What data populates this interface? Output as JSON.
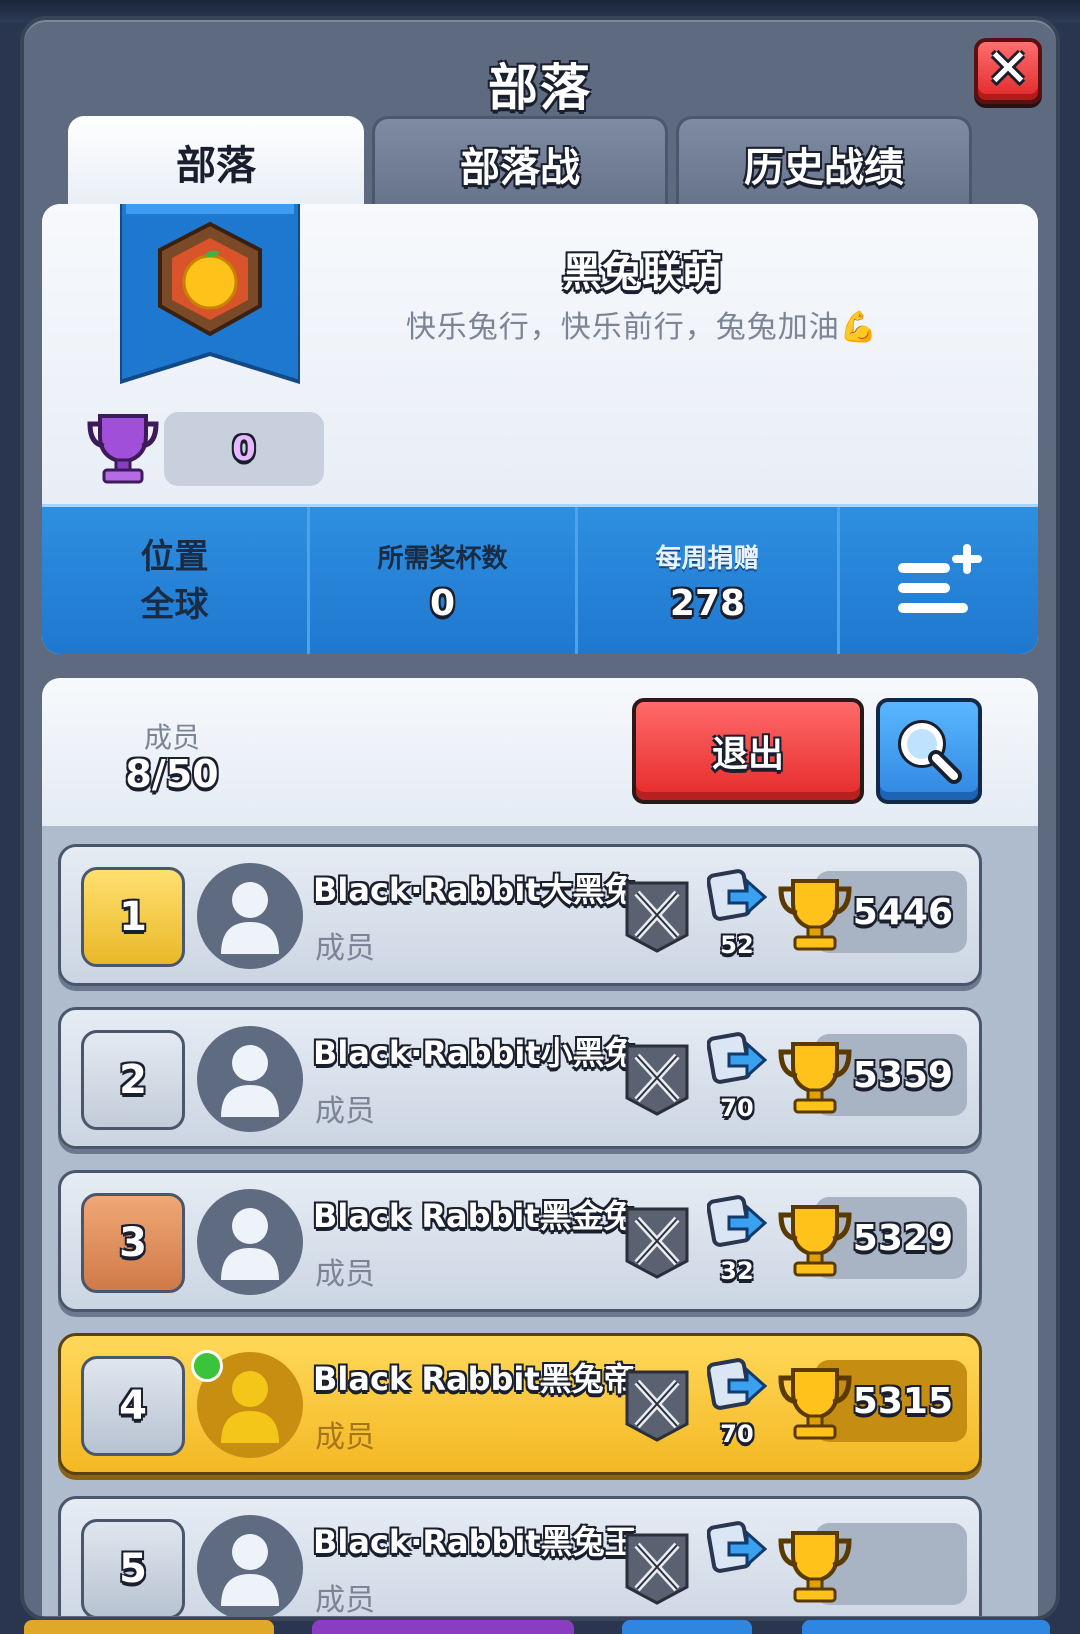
{
  "header": {
    "title": "部落",
    "close_icon": "close-icon"
  },
  "tabs": [
    {
      "label": "部落",
      "active": true
    },
    {
      "label": "部落战",
      "active": false
    },
    {
      "label": "历史战绩",
      "active": false
    }
  ],
  "clan": {
    "name": "黑兔联萌",
    "description": "快乐兔行，快乐前行，兔兔加油💪",
    "trophies": "0",
    "badge_icon": "orange-badge-icon"
  },
  "stats": {
    "location_label": "位置",
    "location_value": "全球",
    "required_trophies_label": "所需奖杯数",
    "required_trophies_value": "0",
    "weekly_donations_label": "每周捐赠",
    "weekly_donations_value": "278",
    "menu_icon": "list-add-icon"
  },
  "members": {
    "label": "成员",
    "count": "8/50",
    "exit_label": "退出",
    "search_icon": "search-icon"
  },
  "member_list": [
    {
      "rank": "1",
      "name": "Black·Rabbit大黑兔",
      "role": "成员",
      "donations": "52",
      "trophies": "5446",
      "rank_style": "gold",
      "online": false,
      "highlight": false
    },
    {
      "rank": "2",
      "name": "Black·Rabbit小黑兔",
      "role": "成员",
      "donations": "70",
      "trophies": "5359",
      "rank_style": "silver",
      "online": false,
      "highlight": false
    },
    {
      "rank": "3",
      "name": "Black Rabbit黑金兔",
      "role": "成员",
      "donations": "32",
      "trophies": "5329",
      "rank_style": "bronze",
      "online": false,
      "highlight": false
    },
    {
      "rank": "4",
      "name": "Black Rabbit黑兔帝",
      "role": "成员",
      "donations": "70",
      "trophies": "5315",
      "rank_style": "plain",
      "online": true,
      "highlight": true
    },
    {
      "rank": "5",
      "name": "Black·Rabbit黑兔王",
      "role": "成员",
      "donations": "",
      "trophies": "",
      "rank_style": "plain",
      "online": false,
      "highlight": false
    }
  ],
  "colors": {
    "panel": "#5d6a80",
    "accent_blue": "#1f78cf",
    "exit_red": "#e52a2a",
    "highlight_gold": "#f4b824"
  }
}
